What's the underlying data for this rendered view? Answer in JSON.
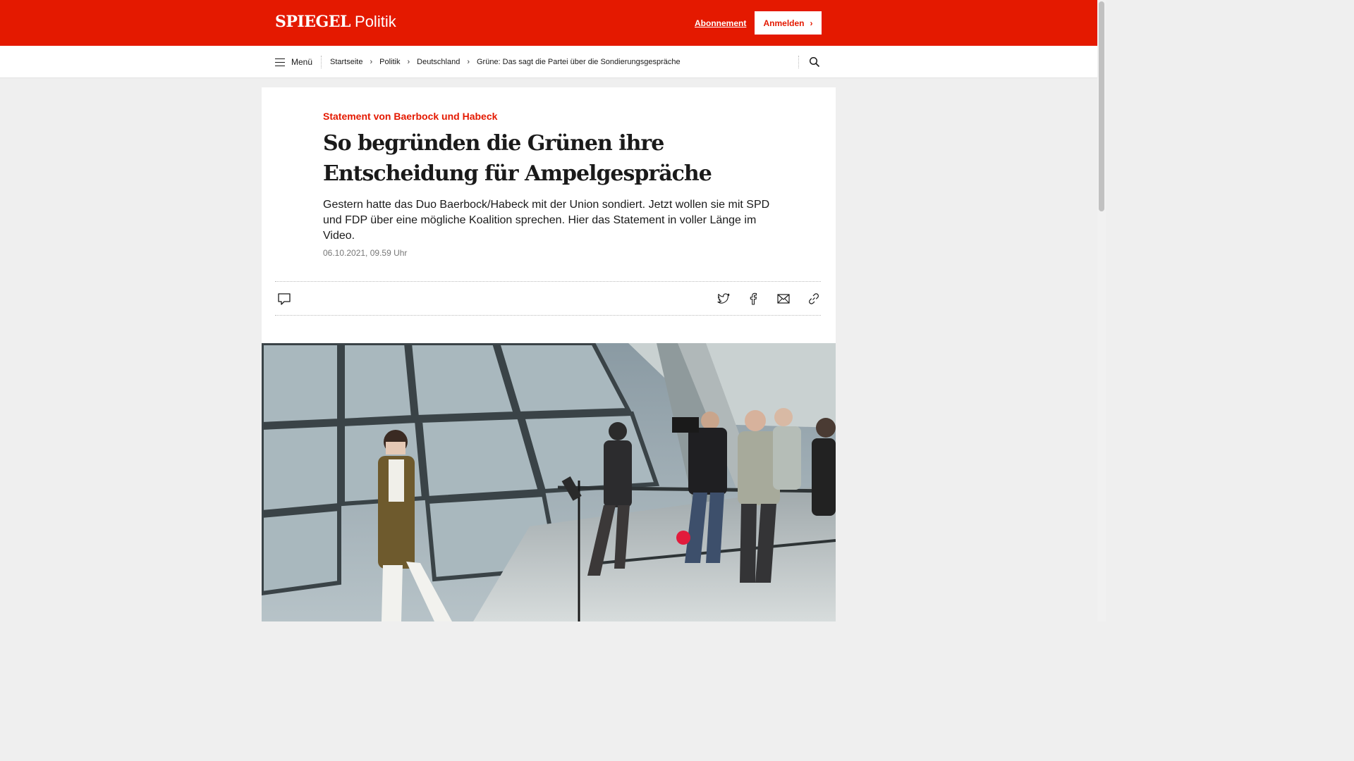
{
  "header": {
    "brand": "SPIEGEL",
    "section": "Politik",
    "subscription_link": "Abonnement",
    "login_button": "Anmelden",
    "brand_color": "#e41900"
  },
  "nav": {
    "menu_label": "Menü",
    "breadcrumbs": [
      "Startseite",
      "Politik",
      "Deutschland",
      "Grüne: Das sagt die Partei über die Sondierungsgespräche"
    ],
    "search_icon": "search-icon"
  },
  "article": {
    "kicker": "Statement von Baerbock und Habeck",
    "headline": "So begründen die Grünen ihre Entscheidung für Ampelgespräche",
    "teaser": "Gestern hatte das Duo Baerbock/Habeck mit der Union sondiert. Jetzt wollen sie mit SPD und FDP über eine mögliche Koalition sprechen. Hier das Statement in voller Länge im Video.",
    "date": "06.10.2021, 09.59 Uhr"
  },
  "share": {
    "icons": [
      "comment-icon",
      "twitter-icon",
      "facebook-icon",
      "mail-icon",
      "link-icon"
    ]
  }
}
